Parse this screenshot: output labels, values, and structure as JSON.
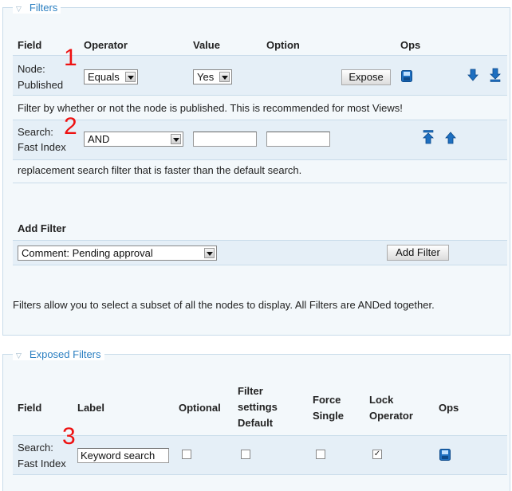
{
  "filters": {
    "legend": "Filters",
    "headers": {
      "field": "Field",
      "operator": "Operator",
      "value": "Value",
      "option": "Option",
      "ops": "Ops"
    },
    "row1": {
      "field_line1": "Node:",
      "field_line2": "Published",
      "operator": "Equals",
      "value": "Yes",
      "expose_label": "Expose",
      "description": "Filter by whether or not the node is published. This is recommended for most Views!"
    },
    "row2": {
      "field_line1": "Search:",
      "field_line2": "Fast Index",
      "operator": "AND",
      "value": "",
      "option": "",
      "description": "replacement search filter that is faster than the default search."
    },
    "add_filter": {
      "heading": "Add Filter",
      "selected": "Comment: Pending approval",
      "button": "Add Filter"
    },
    "help": "Filters allow you to select a subset of all the nodes to display. All Filters are ANDed together."
  },
  "exposed": {
    "legend": "Exposed Filters",
    "headers": {
      "field": "Field",
      "label": "Label",
      "optional": "Optional",
      "filter_line1": "Filter",
      "filter_line2": "settings",
      "filter_line3": "Default",
      "force_line1": "Force",
      "force_line2": "Single",
      "lock_line1": "Lock",
      "lock_line2": "Operator",
      "ops": "Ops"
    },
    "row": {
      "field_line1": "Search:",
      "field_line2": "Fast Index",
      "label_value": "Keyword search",
      "optional": false,
      "filter_default": false,
      "force_single": false,
      "lock_operator": true
    }
  },
  "annotations": {
    "n1": "1",
    "n2": "2",
    "n3": "3"
  },
  "colors": {
    "accent": "#2b7fc1",
    "row_bg": "#e5eff7",
    "fieldset_bg": "#f3f8fb",
    "icon_blue": "#1e6fc0",
    "annotation_red": "#e11111"
  }
}
